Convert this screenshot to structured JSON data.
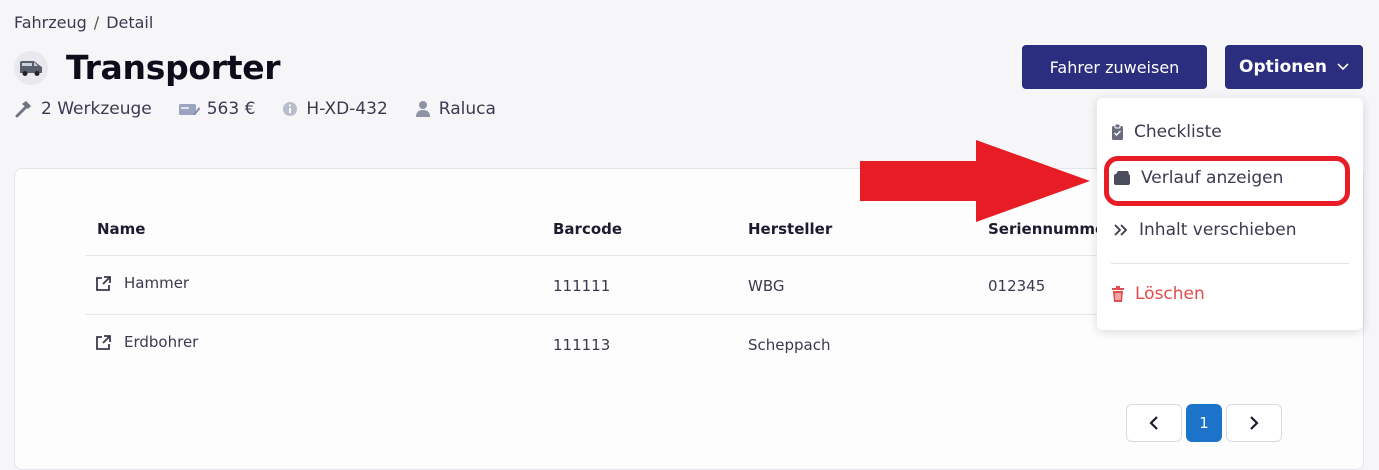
{
  "breadcrumb": {
    "parent": "Fahrzeug",
    "separator": "/",
    "current": "Detail"
  },
  "vehicle": {
    "title": "Transporter",
    "icon": "van-icon"
  },
  "meta": {
    "tools": "2 Werkzeuge",
    "cost": "563 €",
    "plate": "H-XD-432",
    "driver": "Raluca"
  },
  "actions": {
    "assign_driver": "Fahrer zuweisen",
    "options": "Optionen"
  },
  "table": {
    "columns": [
      "Name",
      "Barcode",
      "Hersteller",
      "Seriennumme"
    ],
    "rows": [
      {
        "name": "Hammer",
        "barcode": "111111",
        "manufacturer": "WBG",
        "serial": "012345"
      },
      {
        "name": "Erdbohrer",
        "barcode": "111113",
        "manufacturer": "Scheppach",
        "serial": ""
      }
    ]
  },
  "pagination": {
    "prev": "‹",
    "current_page": "1",
    "next": "›"
  },
  "dropdown": {
    "checklist": "Checkliste",
    "history": "Verlauf anzeigen",
    "move_content": "Inhalt verschieben",
    "delete": "Löschen"
  },
  "colors": {
    "primary": "#2b2d7e",
    "page_active": "#1b74c9",
    "danger": "#e24b4b",
    "annotation": "#e81c24"
  }
}
